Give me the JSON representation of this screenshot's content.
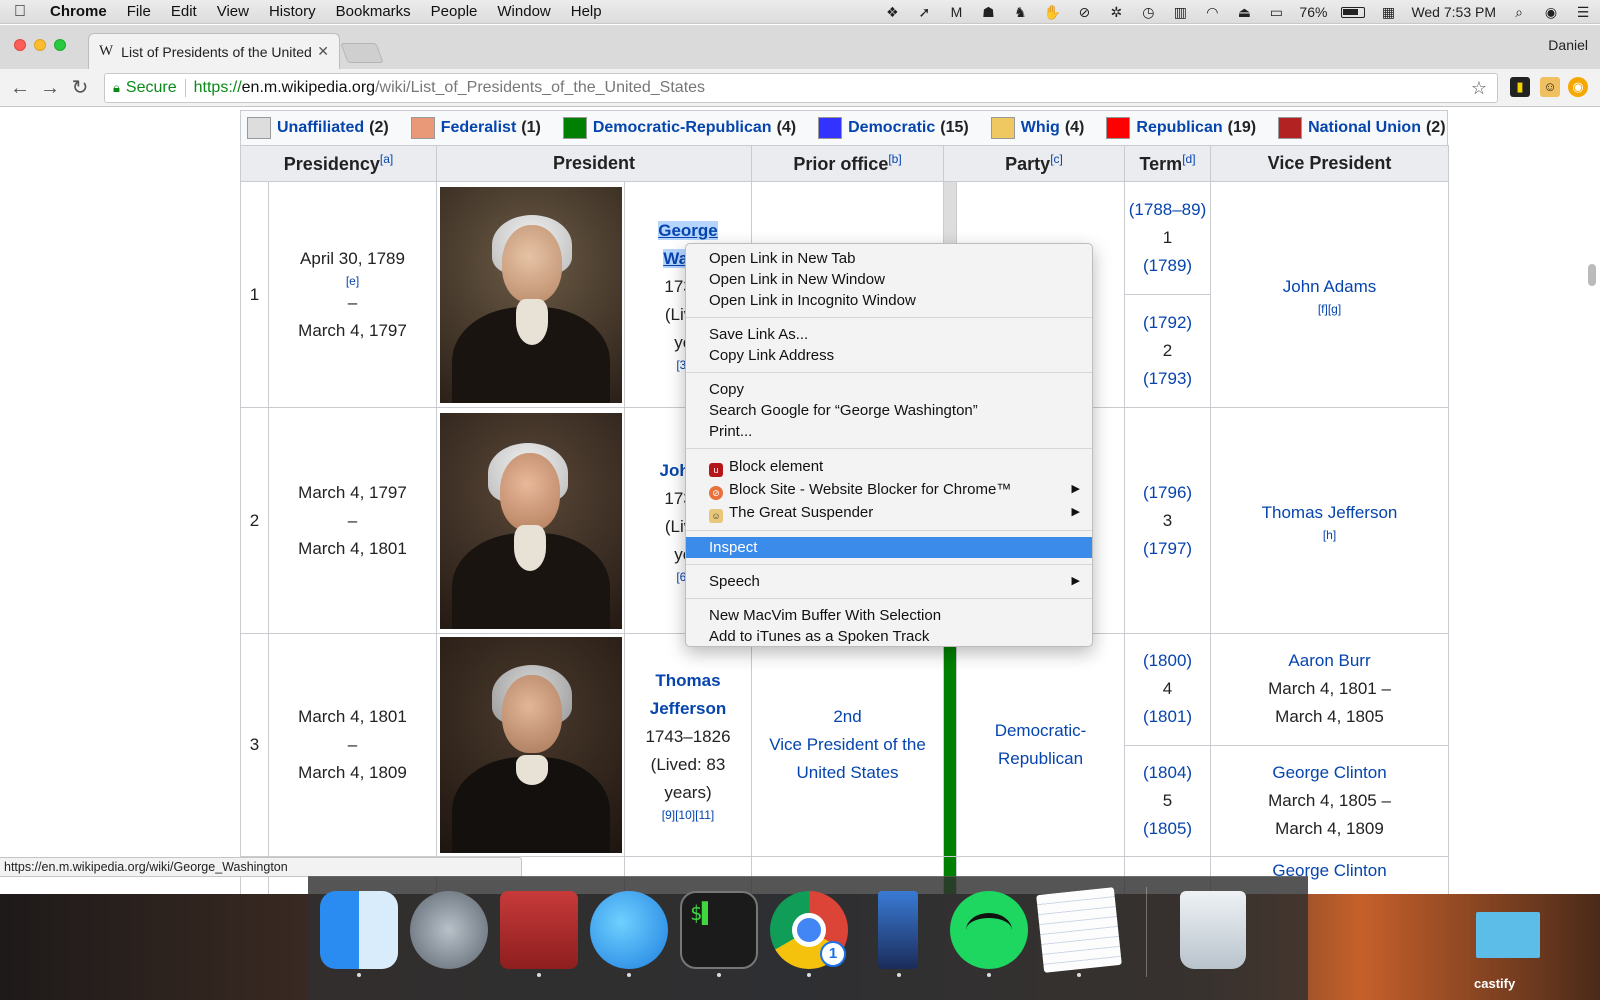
{
  "menubar": {
    "app": "Chrome",
    "items": [
      "File",
      "Edit",
      "View",
      "History",
      "Bookmarks",
      "People",
      "Window",
      "Help"
    ],
    "battery": "76%",
    "clock": "Wed 7:53 PM"
  },
  "tab": {
    "title": "List of Presidents of the United",
    "favicon": "W"
  },
  "profile": "Daniel",
  "omnibox": {
    "secure_label": "Secure",
    "scheme": "https://",
    "host": "en.m.wikipedia.org",
    "path": "/wiki/List_of_Presidents_of_the_United_States"
  },
  "legend": [
    {
      "label": "Unaffiliated",
      "count": "(2)",
      "color": "#dddddd"
    },
    {
      "label": "Federalist",
      "count": "(1)",
      "color": "#ea9978"
    },
    {
      "label": "Democratic-Republican",
      "count": "(4)",
      "color": "#008000"
    },
    {
      "label": "Democratic",
      "count": "(15)",
      "color": "#3333ff"
    },
    {
      "label": "Whig",
      "count": "(4)",
      "color": "#f0c862"
    },
    {
      "label": "Republican",
      "count": "(19)",
      "color": "#ff0000"
    },
    {
      "label": "National Union",
      "count": "(2)",
      "color": "#b22222"
    }
  ],
  "headers": {
    "presidency": "Presidency",
    "presidency_ref": "[a]",
    "president": "President",
    "prior": "Prior office",
    "prior_ref": "[b]",
    "party": "Party",
    "party_ref": "[c]",
    "term": "Term",
    "term_ref": "[d]",
    "vp": "Vice President"
  },
  "rows": [
    {
      "num": "1",
      "start": "April 30, 1789",
      "start_ref": "[e]",
      "dash": "–",
      "end": "March 4, 1797",
      "name1": "George",
      "name2": "Washi",
      "years": "1732–",
      "lived1": "(Lived",
      "lived2": "yea",
      "refs": "[3][4",
      "terms": [
        {
          "a": "(1788–89)",
          "n": "1",
          "b": "(1789)"
        },
        {
          "a": "(1792)",
          "n": "2",
          "b": "(1793)"
        }
      ],
      "vp": "John Adams",
      "vp_ref": "[f][g]"
    },
    {
      "num": "2",
      "start": "March 4, 1797",
      "dash": "–",
      "end": "March 4, 1801",
      "name1": "John A",
      "years": "1735–",
      "lived1": "(Lived",
      "lived2": "yea",
      "refs": "[6][7",
      "terms": [
        {
          "a": "(1796)",
          "n": "3",
          "b": "(1797)"
        }
      ],
      "vp": "Thomas Jefferson",
      "vp_ref": "[h]"
    },
    {
      "num": "3",
      "start": "March 4, 1801",
      "dash": "–",
      "end": "March 4, 1809",
      "name1": "Thomas",
      "name2": "Jefferson",
      "years": "1743–1826",
      "lived1": "(Lived: 83",
      "lived2": "years)",
      "refs": "[9][10][11]",
      "prior1": "2nd",
      "prior2": "Vice President of the",
      "prior3": "United States",
      "party1": "Democratic-",
      "party2": "Republican",
      "terms": [
        {
          "a": "(1800)",
          "n": "4",
          "b": "(1801)"
        },
        {
          "a": "(1804)",
          "n": "5",
          "b": "(1805)"
        }
      ],
      "vps": [
        {
          "name": "Aaron Burr",
          "from": "March 4, 1801 –",
          "to": "March 4, 1805"
        },
        {
          "name": "George Clinton",
          "from": "March 4, 1805 –",
          "to": "March 4, 1809"
        }
      ]
    }
  ],
  "row4_vp": "George Clinton",
  "context_menu": [
    [
      "Open Link in New Tab",
      "Open Link in New Window",
      "Open Link in Incognito Window"
    ],
    [
      "Save Link As...",
      "Copy Link Address"
    ],
    [
      "Copy",
      "Search Google for “George Washington”",
      "Print..."
    ],
    [
      "Block element",
      "Block Site - Website Blocker for Chrome™",
      "The Great Suspender"
    ],
    [
      "Inspect"
    ],
    [
      "Speech"
    ],
    [
      "New MacVim Buffer With Selection",
      "Add to iTunes as a Spoken Track"
    ]
  ],
  "status_url": "https://en.m.wikipedia.org/wiki/George_Washington",
  "dock": {
    "apps": [
      "Finder",
      "Launchpad",
      "Photo Booth",
      "Messages",
      "Terminal",
      "Chrome",
      "Phone",
      "Spotify",
      "TextEdit",
      "Trash"
    ],
    "chrome_badge": "1"
  },
  "desktop_label": "castify"
}
